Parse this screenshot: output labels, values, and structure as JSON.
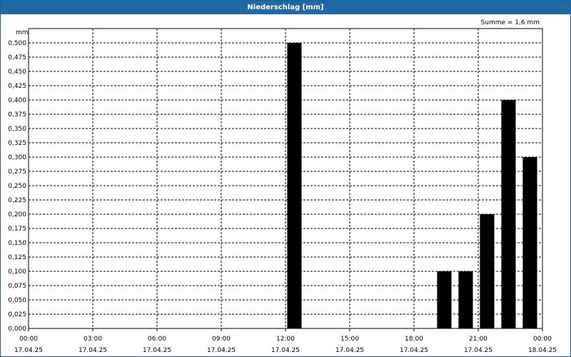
{
  "window": {
    "title": "Niederschlag [mm]"
  },
  "colors": {
    "titlebar": "#1f6aa5",
    "bar": "#000000",
    "grid": "#000000"
  },
  "chart_data": {
    "type": "bar",
    "title": "Niederschlag [mm]",
    "ylabel": "mm",
    "xlabel": "",
    "annotation": "Summe = 1,6 mm",
    "ylim": [
      0,
      0.525
    ],
    "y_ticks": [
      0,
      0.025,
      0.05,
      0.075,
      0.1,
      0.125,
      0.15,
      0.175,
      0.2,
      0.225,
      0.25,
      0.275,
      0.3,
      0.325,
      0.35,
      0.375,
      0.4,
      0.425,
      0.45,
      0.475,
      0.5
    ],
    "y_tick_labels": [
      "0,000",
      "0,025",
      "0,050",
      "0,075",
      "0,100",
      "0,125",
      "0,150",
      "0,175",
      "0,200",
      "0,225",
      "0,250",
      "0,275",
      "0,300",
      "0,325",
      "0,350",
      "0,375",
      "0,400",
      "0,425",
      "0,450",
      "0,475",
      "0,500"
    ],
    "x_range_hours": [
      0,
      24
    ],
    "x_ticks": [
      {
        "hour": 0,
        "time": "00:00",
        "date": "17.04.25"
      },
      {
        "hour": 3,
        "time": "03:00",
        "date": "17.04.25"
      },
      {
        "hour": 6,
        "time": "06:00",
        "date": "17.04.25"
      },
      {
        "hour": 9,
        "time": "09:00",
        "date": "17.04.25"
      },
      {
        "hour": 12,
        "time": "12:00",
        "date": "17.04.25"
      },
      {
        "hour": 15,
        "time": "15:00",
        "date": "17.04.25"
      },
      {
        "hour": 18,
        "time": "18:00",
        "date": "17.04.25"
      },
      {
        "hour": 21,
        "time": "21:00",
        "date": "17.04.25"
      },
      {
        "hour": 24,
        "time": "00:00",
        "date": "18.04.25"
      }
    ],
    "bars": [
      {
        "hour": 12,
        "value": 0.5
      },
      {
        "hour": 19,
        "value": 0.1
      },
      {
        "hour": 20,
        "value": 0.1
      },
      {
        "hour": 21,
        "value": 0.2
      },
      {
        "hour": 22,
        "value": 0.4
      },
      {
        "hour": 23,
        "value": 0.3
      }
    ],
    "grid": true
  }
}
